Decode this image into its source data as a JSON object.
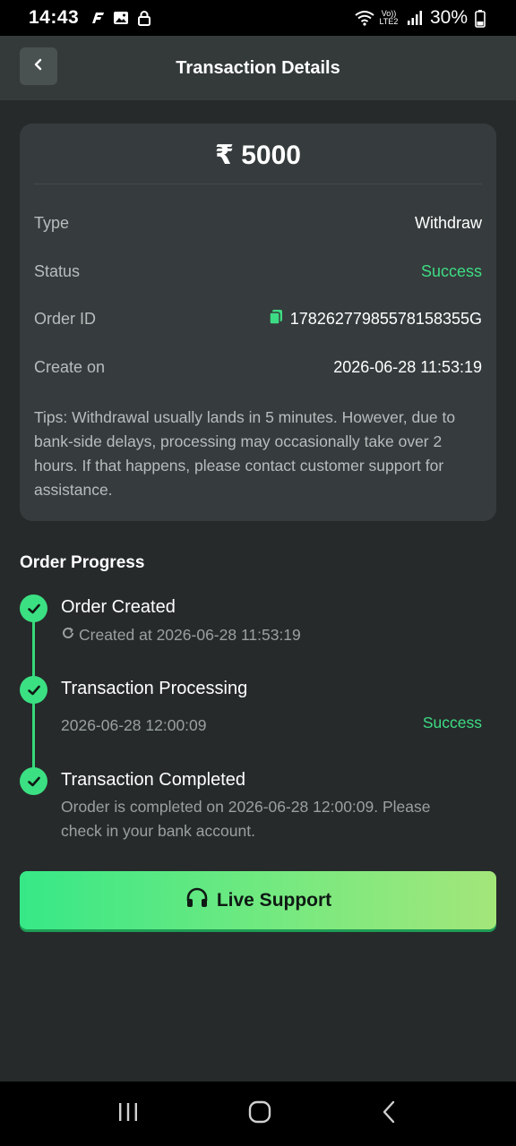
{
  "status_bar": {
    "time": "14:43",
    "network_label": "Vo)) LTE2",
    "battery": "30%"
  },
  "header": {
    "title": "Transaction Details"
  },
  "transaction": {
    "amount": "₹ 5000",
    "rows": [
      {
        "label": "Type",
        "value": "Withdraw"
      },
      {
        "label": "Status",
        "value": "Success"
      },
      {
        "label": "Order ID",
        "value": "17826277985578158355G"
      },
      {
        "label": "Create on",
        "value": "2026-06-28 11:53:19"
      }
    ],
    "tips": "Tips: Withdrawal usually lands in 5 minutes. However, due to bank-side delays, processing may occasionally take over 2 hours. If that happens, please contact customer support for assistance."
  },
  "progress": {
    "title": "Order Progress",
    "steps": [
      {
        "title": "Order Created",
        "sub": "Created at 2026-06-28 11:53:19"
      },
      {
        "title": "Transaction Processing",
        "sub": "2026-06-28 12:00:09",
        "status": "Success"
      },
      {
        "title": "Transaction Completed",
        "sub": "Oroder is completed on 2026-06-28 12:00:09. Please check in your bank account."
      }
    ]
  },
  "support": {
    "label": "Live Support"
  },
  "colors": {
    "accent_green": "#3ddc84",
    "background": "#262a2b",
    "card": "#363c3d"
  }
}
